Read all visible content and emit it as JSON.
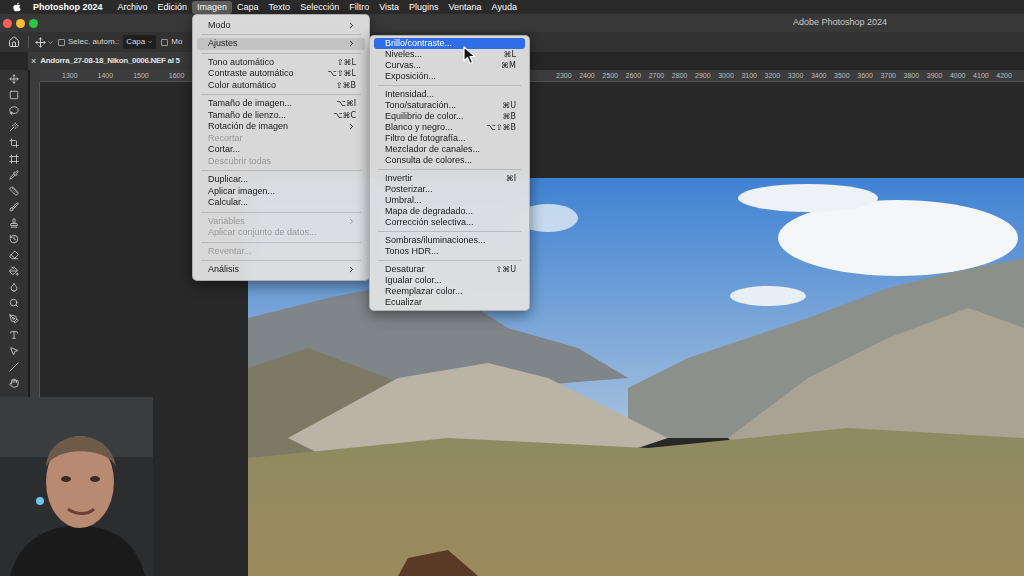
{
  "menu_bar": {
    "app_name": "Photoshop 2024",
    "items": [
      {
        "label": "Archivo",
        "selected": false
      },
      {
        "label": "Edición",
        "selected": false
      },
      {
        "label": "Imagen",
        "selected": true
      },
      {
        "label": "Capa",
        "selected": false
      },
      {
        "label": "Texto",
        "selected": false
      },
      {
        "label": "Selección",
        "selected": false
      },
      {
        "label": "Filtro",
        "selected": false
      },
      {
        "label": "Vista",
        "selected": false
      },
      {
        "label": "Plugins",
        "selected": false
      },
      {
        "label": "Ventana",
        "selected": false
      },
      {
        "label": "Ayuda",
        "selected": false
      }
    ]
  },
  "window": {
    "title": "Adobe Photoshop 2024"
  },
  "options_bar": {
    "auto_select": {
      "label": "Selec. autom.:",
      "checked": false
    },
    "auto_select_target": "Capa",
    "transform_controls": {
      "label": "Mo",
      "checked": false
    }
  },
  "document_tab": {
    "close": "×",
    "title": "Andorra_27-08-18_Nikon_0006.NEF al 5"
  },
  "rulers": {
    "horizontal_left": [
      "1300",
      "1400",
      "1500",
      "1600"
    ],
    "horizontal_right": [
      "2300",
      "2400",
      "2500",
      "2600",
      "2700",
      "2800",
      "2900",
      "3000",
      "3100",
      "3200",
      "3300",
      "3400",
      "3500",
      "3600",
      "3700",
      "3800",
      "3900",
      "4000",
      "4100",
      "4200"
    ]
  },
  "image_menu": [
    {
      "kind": "item",
      "label": "Modo",
      "shortcut": "",
      "submenu": true,
      "disabled": false,
      "selected": false
    },
    {
      "kind": "separator"
    },
    {
      "kind": "item",
      "label": "Ajustes",
      "shortcut": "",
      "submenu": true,
      "disabled": false,
      "selected": true
    },
    {
      "kind": "separator"
    },
    {
      "kind": "item",
      "label": "Tono automático",
      "shortcut": "⇧⌘L",
      "submenu": false,
      "disabled": false,
      "selected": false
    },
    {
      "kind": "item",
      "label": "Contraste automático",
      "shortcut": "⌥⇧⌘L",
      "submenu": false,
      "disabled": false,
      "selected": false
    },
    {
      "kind": "item",
      "label": "Color automático",
      "shortcut": "⇧⌘B",
      "submenu": false,
      "disabled": false,
      "selected": false
    },
    {
      "kind": "separator"
    },
    {
      "kind": "item",
      "label": "Tamaño de imagen...",
      "shortcut": "⌥⌘I",
      "submenu": false,
      "disabled": false,
      "selected": false
    },
    {
      "kind": "item",
      "label": "Tamaño de lienzo...",
      "shortcut": "⌥⌘C",
      "submenu": false,
      "disabled": false,
      "selected": false
    },
    {
      "kind": "item",
      "label": "Rotación de imagen",
      "shortcut": "",
      "submenu": true,
      "disabled": false,
      "selected": false
    },
    {
      "kind": "item",
      "label": "Recortar",
      "shortcut": "",
      "submenu": false,
      "disabled": true,
      "selected": false
    },
    {
      "kind": "item",
      "label": "Cortar...",
      "shortcut": "",
      "submenu": false,
      "disabled": false,
      "selected": false
    },
    {
      "kind": "item",
      "label": "Descubrir todas",
      "shortcut": "",
      "submenu": false,
      "disabled": true,
      "selected": false
    },
    {
      "kind": "separator"
    },
    {
      "kind": "item",
      "label": "Duplicar...",
      "shortcut": "",
      "submenu": false,
      "disabled": false,
      "selected": false
    },
    {
      "kind": "item",
      "label": "Aplicar imagen...",
      "shortcut": "",
      "submenu": false,
      "disabled": false,
      "selected": false
    },
    {
      "kind": "item",
      "label": "Calcular...",
      "shortcut": "",
      "submenu": false,
      "disabled": false,
      "selected": false
    },
    {
      "kind": "separator"
    },
    {
      "kind": "item",
      "label": "Variables",
      "shortcut": "",
      "submenu": true,
      "disabled": true,
      "selected": false
    },
    {
      "kind": "item",
      "label": "Aplicar conjunto de datos...",
      "shortcut": "",
      "submenu": false,
      "disabled": true,
      "selected": false
    },
    {
      "kind": "separator"
    },
    {
      "kind": "item",
      "label": "Reventar...",
      "shortcut": "",
      "submenu": false,
      "disabled": true,
      "selected": false
    },
    {
      "kind": "separator"
    },
    {
      "kind": "item",
      "label": "Análisis",
      "shortcut": "",
      "submenu": true,
      "disabled": false,
      "selected": false
    }
  ],
  "adjustments_menu": [
    {
      "kind": "item",
      "label": "Brillo/contraste...",
      "shortcut": "",
      "submenu": false,
      "disabled": false,
      "selected": true
    },
    {
      "kind": "item",
      "label": "Niveles...",
      "shortcut": "⌘L",
      "submenu": false,
      "disabled": false,
      "selected": false
    },
    {
      "kind": "item",
      "label": "Curvas...",
      "shortcut": "⌘M",
      "submenu": false,
      "disabled": false,
      "selected": false
    },
    {
      "kind": "item",
      "label": "Exposición...",
      "shortcut": "",
      "submenu": false,
      "disabled": false,
      "selected": false
    },
    {
      "kind": "separator"
    },
    {
      "kind": "item",
      "label": "Intensidad...",
      "shortcut": "",
      "submenu": false,
      "disabled": false,
      "selected": false
    },
    {
      "kind": "item",
      "label": "Tono/saturación...",
      "shortcut": "⌘U",
      "submenu": false,
      "disabled": false,
      "selected": false
    },
    {
      "kind": "item",
      "label": "Equilibrio de color...",
      "shortcut": "⌘B",
      "submenu": false,
      "disabled": false,
      "selected": false
    },
    {
      "kind": "item",
      "label": "Blanco y negro...",
      "shortcut": "⌥⇧⌘B",
      "submenu": false,
      "disabled": false,
      "selected": false
    },
    {
      "kind": "item",
      "label": "Filtro de fotografía...",
      "shortcut": "",
      "submenu": false,
      "disabled": false,
      "selected": false
    },
    {
      "kind": "item",
      "label": "Mezclador de canales...",
      "shortcut": "",
      "submenu": false,
      "disabled": false,
      "selected": false
    },
    {
      "kind": "item",
      "label": "Consulta de colores...",
      "shortcut": "",
      "submenu": false,
      "disabled": false,
      "selected": false
    },
    {
      "kind": "separator"
    },
    {
      "kind": "item",
      "label": "Invertir",
      "shortcut": "⌘I",
      "submenu": false,
      "disabled": false,
      "selected": false
    },
    {
      "kind": "item",
      "label": "Posterizar...",
      "shortcut": "",
      "submenu": false,
      "disabled": false,
      "selected": false
    },
    {
      "kind": "item",
      "label": "Umbral...",
      "shortcut": "",
      "submenu": false,
      "disabled": false,
      "selected": false
    },
    {
      "kind": "item",
      "label": "Mapa de degradado...",
      "shortcut": "",
      "submenu": false,
      "disabled": false,
      "selected": false
    },
    {
      "kind": "item",
      "label": "Corrección selectiva...",
      "shortcut": "",
      "submenu": false,
      "disabled": false,
      "selected": false
    },
    {
      "kind": "separator"
    },
    {
      "kind": "item",
      "label": "Sombras/iluminaciones...",
      "shortcut": "",
      "submenu": false,
      "disabled": false,
      "selected": false
    },
    {
      "kind": "item",
      "label": "Tonos HDR...",
      "shortcut": "",
      "submenu": false,
      "disabled": false,
      "selected": false
    },
    {
      "kind": "separator"
    },
    {
      "kind": "item",
      "label": "Desaturar",
      "shortcut": "⇧⌘U",
      "submenu": false,
      "disabled": false,
      "selected": false
    },
    {
      "kind": "item",
      "label": "Igualar color...",
      "shortcut": "",
      "submenu": false,
      "disabled": false,
      "selected": false
    },
    {
      "kind": "item",
      "label": "Reemplazar color...",
      "shortcut": "",
      "submenu": false,
      "disabled": false,
      "selected": false
    },
    {
      "kind": "item",
      "label": "Ecualizar",
      "shortcut": "",
      "submenu": false,
      "disabled": false,
      "selected": false
    }
  ]
}
